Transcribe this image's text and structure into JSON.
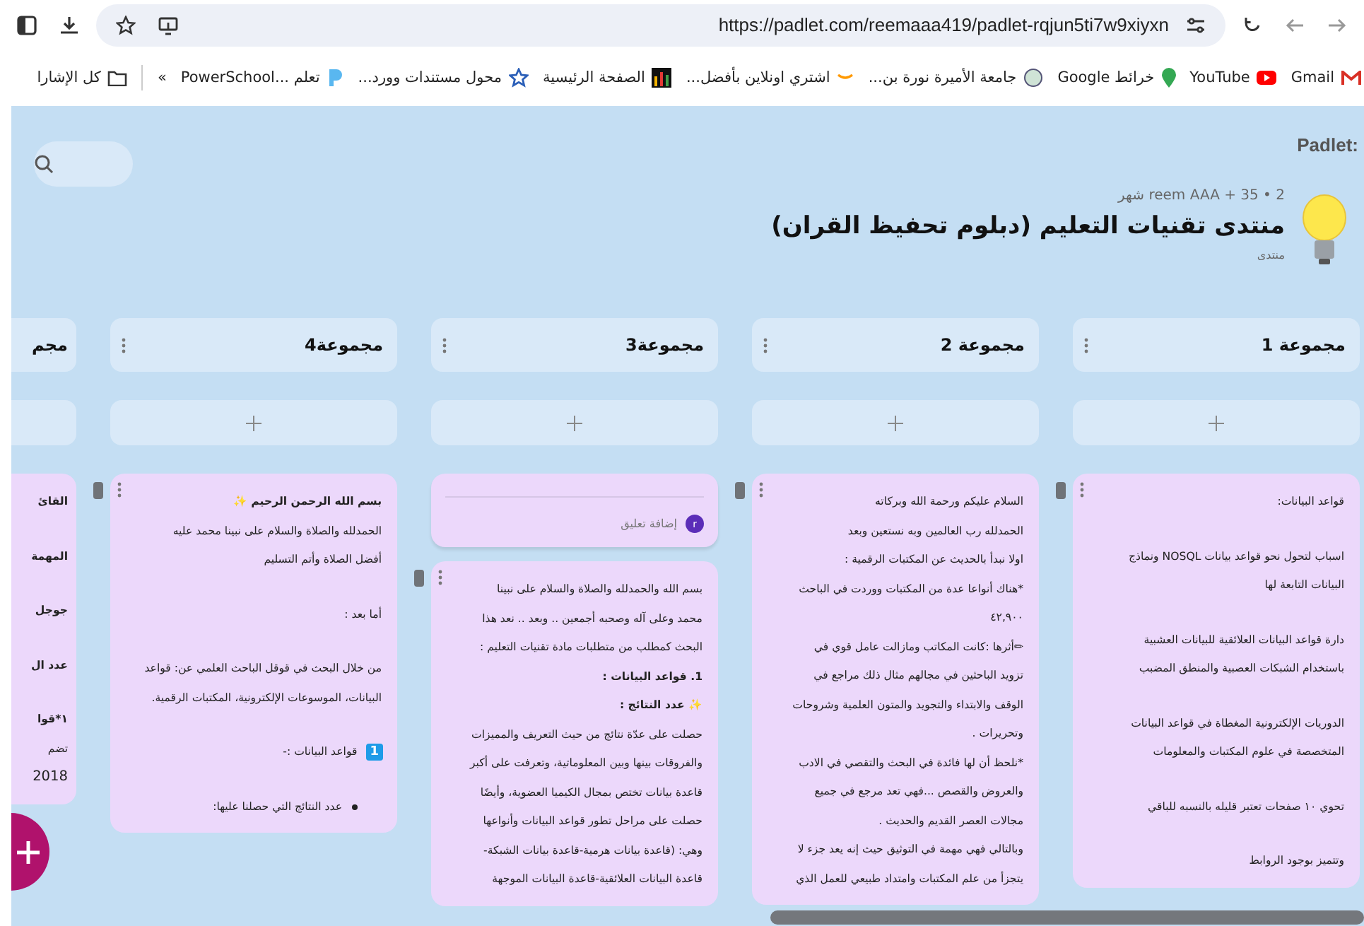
{
  "browser": {
    "url": "https://padlet.com/reemaaa419/padlet-rqjun5ti7w9xiyxn"
  },
  "bookmarks": [
    {
      "label": "Gmail",
      "kind": "gmail"
    },
    {
      "label": "YouTube",
      "kind": "youtube"
    },
    {
      "label": "خرائط Google",
      "kind": "maps"
    },
    {
      "label": "جامعة الأميرة نورة بن...",
      "kind": "seal"
    },
    {
      "label": "اشتري اونلاين بأفضل...",
      "kind": "amazon"
    },
    {
      "label": "الصفحة الرئيسية",
      "kind": "bars"
    },
    {
      "label": "محول مستندات وورد...",
      "kind": "star"
    },
    {
      "label": "تعلم ...PowerSchool",
      "kind": "p"
    }
  ],
  "more_bookmarks": "»",
  "all_bookmarks": "كل الإشارا",
  "padlet": {
    "logo": ":Padlet",
    "meta": "reem AAA + 35 • 2 شهر",
    "title": "منتدى تقنيات التعليم (دبلوم تحفيظ القران)",
    "subtitle": "منتدى"
  },
  "columns": [
    {
      "title": "مجموعة 1",
      "clipped": false,
      "posts": [
        {
          "kind": "post",
          "blocks": [
            [
              {
                "kind": "text",
                "text": "قواعد البيانات:"
              }
            ],
            [
              {
                "kind": "text",
                "text": "اسباب لتحول نحو قواعد بيانات NOSQL ونماذج"
              },
              {
                "kind": "text",
                "text": "البيانات التابعة لها"
              }
            ],
            [
              {
                "kind": "text",
                "text": "دارة قواعد البيانات العلائقية للبيانات العشبية"
              },
              {
                "kind": "text",
                "text": "باستخدام الشبكات العصبية والمنطق المضبب"
              }
            ],
            [
              {
                "kind": "text",
                "text": "الدوريات الإلكترونية المغطاة في قواعد البيانات"
              },
              {
                "kind": "text",
                "text": "المتخصصة في علوم المكتبات والمعلومات"
              }
            ],
            [
              {
                "kind": "text",
                "text": "تحوي ١٠ صفحات تعتبر قليله بالنسبه للباقي"
              }
            ],
            [
              {
                "kind": "text",
                "text": "وتتميز بوجود الروابط"
              }
            ]
          ]
        }
      ]
    },
    {
      "title": "مجموعة 2",
      "clipped": false,
      "posts": [
        {
          "kind": "post",
          "blocks": [
            [
              {
                "kind": "text",
                "text": "السلام عليكم ورحمة الله وبركاته"
              },
              {
                "kind": "text",
                "text": "الحمدلله رب العالمين وبه نستعين وبعد"
              },
              {
                "kind": "text",
                "text": "اولا نبدأ بالحديث عن المكتبات الرقمية :"
              },
              {
                "kind": "text",
                "text": "*هناك أنواعا عدة من المكتبات ووردت  في الباحث"
              },
              {
                "kind": "text",
                "text": "٤٢,٩٠٠"
              },
              {
                "kind": "text",
                "text": "✏أثرها :كانت المكاتب ومازالت عامل قوي في"
              },
              {
                "kind": "text",
                "text": "تزويد الباحثين في مجالهم مثال ذلك مراجع في"
              },
              {
                "kind": "text",
                "text": "الوقف والابتداء والتجويد والمتون العلمية وشروحات"
              },
              {
                "kind": "text",
                "text": "وتحريرات ."
              },
              {
                "kind": "text",
                "text": "*نلحظ أن  لها فائدة في البحث والتقصي في الادب"
              },
              {
                "kind": "text",
                "text": "والعروض والقصص  ...فهي تعد مرجع في جميع"
              },
              {
                "kind": "text",
                "text": "مجالات العصر القديم والحديث ."
              },
              {
                "kind": "text",
                "text": "وبالتالي فهي مهمة في التوثيق حيث إنه يعد جزء لا"
              },
              {
                "kind": "text",
                "text": "يتجزأ من علم المكتبات وامتداد طبيعي للعمل الذي"
              }
            ]
          ]
        }
      ]
    },
    {
      "title": "مجموعة3",
      "clipped": false,
      "posts": [
        {
          "kind": "comment_footer",
          "avatar": "r",
          "comment_prompt": "إضافة تعليق"
        },
        {
          "kind": "post",
          "blocks": [
            [
              {
                "kind": "text",
                "text": "بسم الله والحمدلله والصلاة والسلام على نبينا"
              },
              {
                "kind": "text",
                "text": "محمد وعلى آله وصحبه أجمعين .. وبعد .. نعد هذا"
              },
              {
                "kind": "text",
                "text": "البحث  كمطلب من متطلبات مادة تقنيات التعليم :"
              },
              {
                "kind": "heading",
                "text": "1. قواعد البيانات :"
              },
              {
                "kind": "heading",
                "text": "✨ عدد النتائج :"
              },
              {
                "kind": "text",
                "text": "حصلت على عدّة نتائج من حيث التعريف والمميزات"
              },
              {
                "kind": "text",
                "text": "والفروقات بينها وبين المعلوماتية، وتعرفت على أكبر"
              },
              {
                "kind": "text",
                "text": "قاعدة بيانات تختص بمجال الكيميا العضوية، وأيضًا"
              },
              {
                "kind": "text",
                "text": "حصلت على مراحل تطور قواعد البيانات وأنواعها"
              },
              {
                "kind": "text",
                "text": "وهي: (قاعدة بيانات هرمية-قاعدة بيانات الشبكة-"
              },
              {
                "kind": "text",
                "text": "قاعدة البيانات العلائقية-قاعدة البيانات الموجهة"
              }
            ]
          ]
        }
      ]
    },
    {
      "title": "مجموعة4",
      "clipped": false,
      "posts": [
        {
          "kind": "post",
          "blocks": [
            [
              {
                "kind": "heading",
                "text": "بسم الله الرحمن الرحيم ✨"
              },
              {
                "kind": "text",
                "text": "الحمدلله والصلاة والسلام على نبينا محمد عليه"
              },
              {
                "kind": "text",
                "text": "أفضل الصلاة وأتم التسليم"
              }
            ],
            [
              {
                "kind": "text",
                "text": "أما بعد :"
              }
            ],
            [
              {
                "kind": "text",
                "text": "من خلال البحث في قوقل الباحث العلمي عن: قواعد"
              },
              {
                "kind": "text",
                "text": "البيانات، الموسوعات الإلكترونية، المكتبات الرقمية."
              }
            ],
            [
              {
                "kind": "numbered",
                "number": "1",
                "text": "قواعد البيانات :-"
              }
            ],
            [
              {
                "kind": "bullet",
                "text": "عدد النتائج التي حصلنا عليها:"
              }
            ]
          ]
        }
      ]
    },
    {
      "title": "مجم",
      "clipped": true,
      "posts": [
        {
          "kind": "post",
          "blocks": [
            [
              {
                "kind": "heading",
                "text": "القائ"
              }
            ],
            [
              {
                "kind": "heading",
                "text": "المهمة"
              }
            ],
            [
              {
                "kind": "heading",
                "text": "جوجل"
              }
            ],
            [
              {
                "kind": "heading",
                "text": "عدد ال"
              }
            ],
            [
              {
                "kind": "heading",
                "text": "١*قوا"
              },
              {
                "kind": "text",
                "text": "تضم"
              },
              {
                "kind": "year",
                "text": "2018"
              }
            ]
          ]
        }
      ]
    }
  ]
}
